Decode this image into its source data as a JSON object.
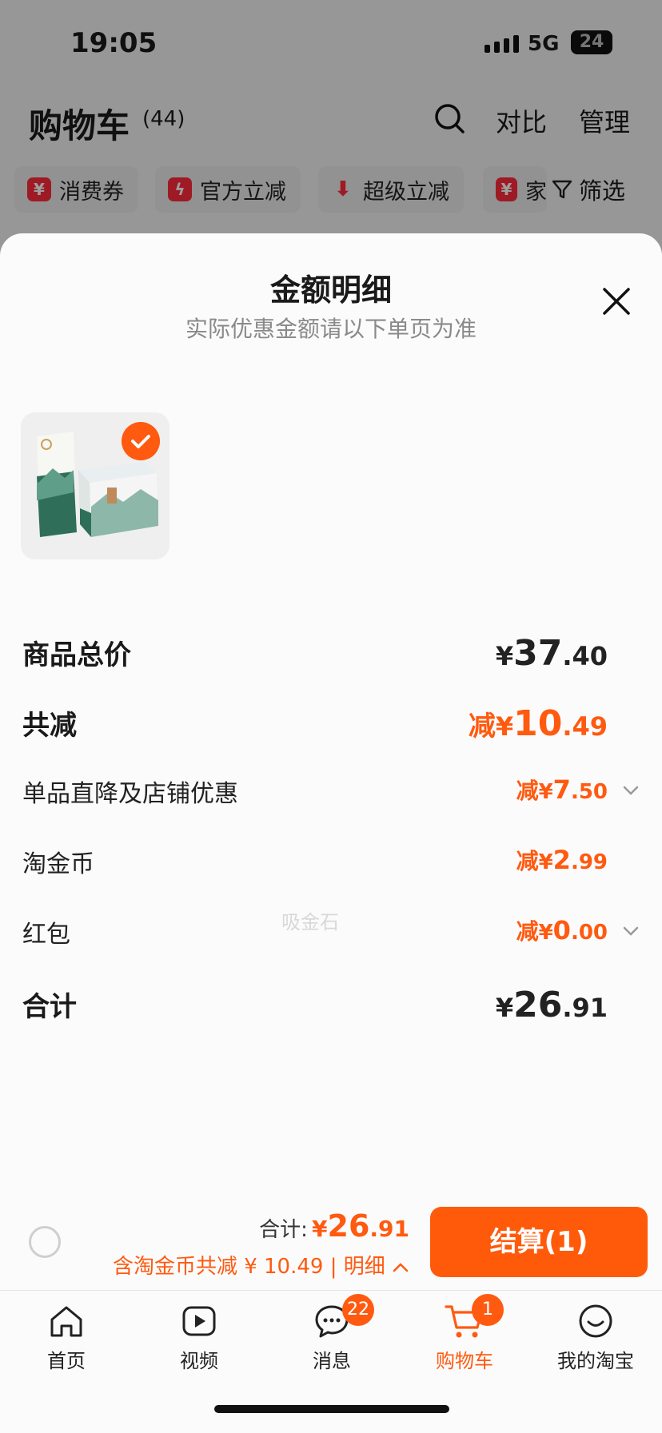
{
  "status_bar": {
    "time": "19:05",
    "network": "5G",
    "battery": "24"
  },
  "cart_header": {
    "title": "购物车",
    "count": "(44)",
    "compare_label": "对比",
    "manage_label": "管理"
  },
  "filters": {
    "chips": [
      {
        "label": "消费券",
        "icon": "coupon-icon"
      },
      {
        "label": "官方立减",
        "icon": "flash-icon"
      },
      {
        "label": "超级立减",
        "icon": "arrow-down-icon"
      },
      {
        "label": "家",
        "icon": "coupon-icon"
      }
    ],
    "filter_label": "筛选"
  },
  "sheet": {
    "title": "金额明细",
    "subtitle": "实际优惠金额请以下单页为准",
    "rows": [
      {
        "label": "商品总价",
        "prefix": "",
        "currency": "¥",
        "int": "37",
        "dec": ".40"
      },
      {
        "label": "共减",
        "prefix": "减",
        "currency": "¥",
        "int": "10",
        "dec": ".49"
      },
      {
        "label": "单品直降及店铺优惠",
        "prefix": "减",
        "currency": "¥",
        "int": "7",
        "dec": ".50"
      },
      {
        "label": "淘金币",
        "prefix": "减",
        "currency": "¥",
        "int": "2",
        "dec": ".99"
      },
      {
        "label": "红包",
        "prefix": "减",
        "currency": "¥",
        "int": "0",
        "dec": ".00"
      },
      {
        "label": "合计",
        "prefix": "",
        "currency": "¥",
        "int": "26",
        "dec": ".91"
      }
    ],
    "watermark": "吸金石"
  },
  "checkout": {
    "total_label": "合计:",
    "total_currency": "¥",
    "total_int": "26",
    "total_dec": ".91",
    "saving_text": "含淘金币共减 ¥ 10.49 | 明细",
    "pay_label": "结算(1)"
  },
  "tabbar": [
    {
      "label": "首页",
      "icon": "home-icon"
    },
    {
      "label": "视频",
      "icon": "video-icon"
    },
    {
      "label": "消息",
      "icon": "message-icon",
      "badge": "22"
    },
    {
      "label": "购物车",
      "icon": "cart-icon",
      "badge": "1",
      "active": true
    },
    {
      "label": "我的淘宝",
      "icon": "smile-icon"
    }
  ],
  "colors": {
    "accent": "#ff5a10",
    "badge_red": "#ff2a3a"
  }
}
